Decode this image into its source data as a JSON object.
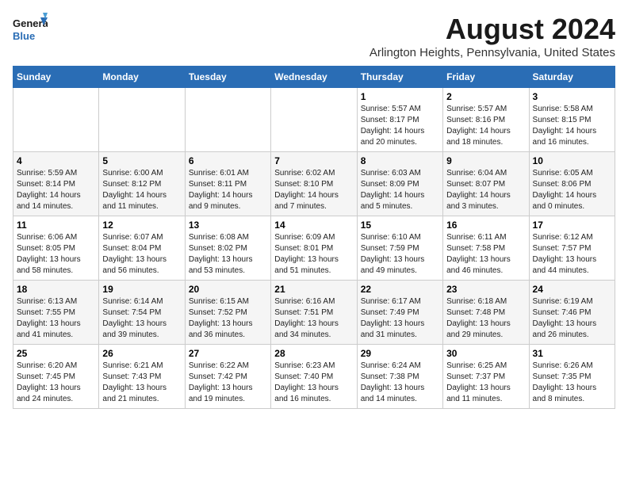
{
  "logo": {
    "line1": "General",
    "line2": "Blue"
  },
  "title": "August 2024",
  "subtitle": "Arlington Heights, Pennsylvania, United States",
  "days_of_week": [
    "Sunday",
    "Monday",
    "Tuesday",
    "Wednesday",
    "Thursday",
    "Friday",
    "Saturday"
  ],
  "weeks": [
    [
      {
        "day": "",
        "info": ""
      },
      {
        "day": "",
        "info": ""
      },
      {
        "day": "",
        "info": ""
      },
      {
        "day": "",
        "info": ""
      },
      {
        "day": "1",
        "info": "Sunrise: 5:57 AM\nSunset: 8:17 PM\nDaylight: 14 hours\nand 20 minutes."
      },
      {
        "day": "2",
        "info": "Sunrise: 5:57 AM\nSunset: 8:16 PM\nDaylight: 14 hours\nand 18 minutes."
      },
      {
        "day": "3",
        "info": "Sunrise: 5:58 AM\nSunset: 8:15 PM\nDaylight: 14 hours\nand 16 minutes."
      }
    ],
    [
      {
        "day": "4",
        "info": "Sunrise: 5:59 AM\nSunset: 8:14 PM\nDaylight: 14 hours\nand 14 minutes."
      },
      {
        "day": "5",
        "info": "Sunrise: 6:00 AM\nSunset: 8:12 PM\nDaylight: 14 hours\nand 11 minutes."
      },
      {
        "day": "6",
        "info": "Sunrise: 6:01 AM\nSunset: 8:11 PM\nDaylight: 14 hours\nand 9 minutes."
      },
      {
        "day": "7",
        "info": "Sunrise: 6:02 AM\nSunset: 8:10 PM\nDaylight: 14 hours\nand 7 minutes."
      },
      {
        "day": "8",
        "info": "Sunrise: 6:03 AM\nSunset: 8:09 PM\nDaylight: 14 hours\nand 5 minutes."
      },
      {
        "day": "9",
        "info": "Sunrise: 6:04 AM\nSunset: 8:07 PM\nDaylight: 14 hours\nand 3 minutes."
      },
      {
        "day": "10",
        "info": "Sunrise: 6:05 AM\nSunset: 8:06 PM\nDaylight: 14 hours\nand 0 minutes."
      }
    ],
    [
      {
        "day": "11",
        "info": "Sunrise: 6:06 AM\nSunset: 8:05 PM\nDaylight: 13 hours\nand 58 minutes."
      },
      {
        "day": "12",
        "info": "Sunrise: 6:07 AM\nSunset: 8:04 PM\nDaylight: 13 hours\nand 56 minutes."
      },
      {
        "day": "13",
        "info": "Sunrise: 6:08 AM\nSunset: 8:02 PM\nDaylight: 13 hours\nand 53 minutes."
      },
      {
        "day": "14",
        "info": "Sunrise: 6:09 AM\nSunset: 8:01 PM\nDaylight: 13 hours\nand 51 minutes."
      },
      {
        "day": "15",
        "info": "Sunrise: 6:10 AM\nSunset: 7:59 PM\nDaylight: 13 hours\nand 49 minutes."
      },
      {
        "day": "16",
        "info": "Sunrise: 6:11 AM\nSunset: 7:58 PM\nDaylight: 13 hours\nand 46 minutes."
      },
      {
        "day": "17",
        "info": "Sunrise: 6:12 AM\nSunset: 7:57 PM\nDaylight: 13 hours\nand 44 minutes."
      }
    ],
    [
      {
        "day": "18",
        "info": "Sunrise: 6:13 AM\nSunset: 7:55 PM\nDaylight: 13 hours\nand 41 minutes."
      },
      {
        "day": "19",
        "info": "Sunrise: 6:14 AM\nSunset: 7:54 PM\nDaylight: 13 hours\nand 39 minutes."
      },
      {
        "day": "20",
        "info": "Sunrise: 6:15 AM\nSunset: 7:52 PM\nDaylight: 13 hours\nand 36 minutes."
      },
      {
        "day": "21",
        "info": "Sunrise: 6:16 AM\nSunset: 7:51 PM\nDaylight: 13 hours\nand 34 minutes."
      },
      {
        "day": "22",
        "info": "Sunrise: 6:17 AM\nSunset: 7:49 PM\nDaylight: 13 hours\nand 31 minutes."
      },
      {
        "day": "23",
        "info": "Sunrise: 6:18 AM\nSunset: 7:48 PM\nDaylight: 13 hours\nand 29 minutes."
      },
      {
        "day": "24",
        "info": "Sunrise: 6:19 AM\nSunset: 7:46 PM\nDaylight: 13 hours\nand 26 minutes."
      }
    ],
    [
      {
        "day": "25",
        "info": "Sunrise: 6:20 AM\nSunset: 7:45 PM\nDaylight: 13 hours\nand 24 minutes."
      },
      {
        "day": "26",
        "info": "Sunrise: 6:21 AM\nSunset: 7:43 PM\nDaylight: 13 hours\nand 21 minutes."
      },
      {
        "day": "27",
        "info": "Sunrise: 6:22 AM\nSunset: 7:42 PM\nDaylight: 13 hours\nand 19 minutes."
      },
      {
        "day": "28",
        "info": "Sunrise: 6:23 AM\nSunset: 7:40 PM\nDaylight: 13 hours\nand 16 minutes."
      },
      {
        "day": "29",
        "info": "Sunrise: 6:24 AM\nSunset: 7:38 PM\nDaylight: 13 hours\nand 14 minutes."
      },
      {
        "day": "30",
        "info": "Sunrise: 6:25 AM\nSunset: 7:37 PM\nDaylight: 13 hours\nand 11 minutes."
      },
      {
        "day": "31",
        "info": "Sunrise: 6:26 AM\nSunset: 7:35 PM\nDaylight: 13 hours\nand 8 minutes."
      }
    ]
  ]
}
